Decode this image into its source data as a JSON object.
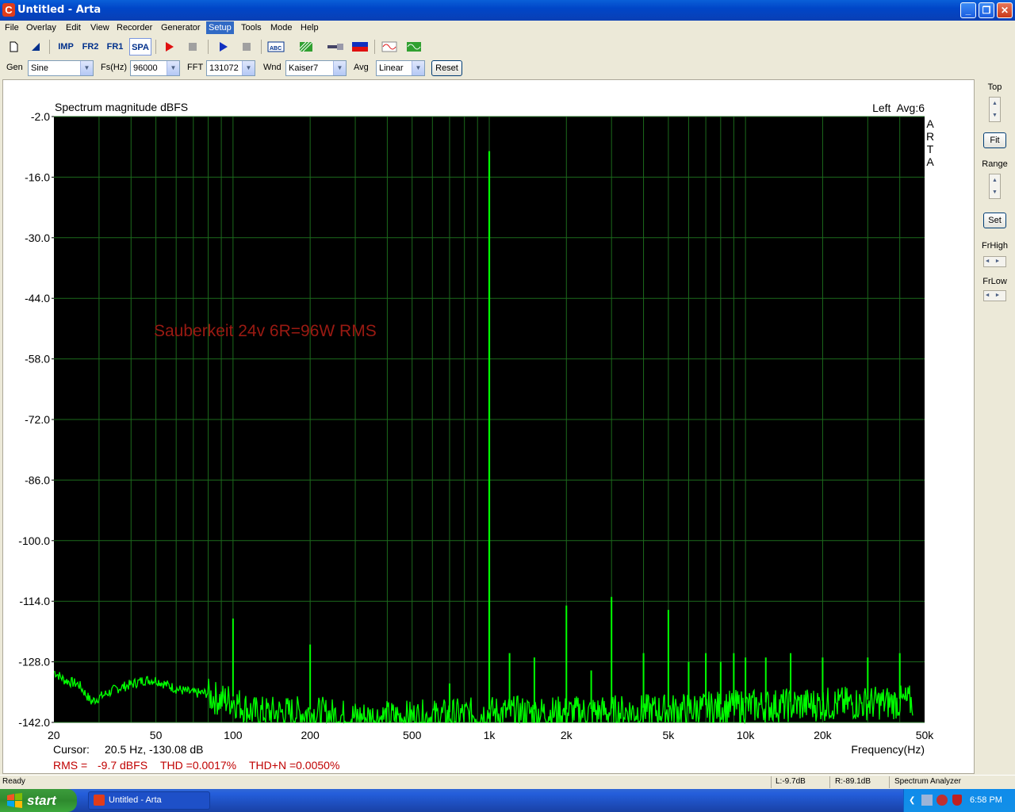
{
  "window": {
    "icon": "C",
    "title": "Untitled - Arta",
    "buttons": {
      "minimize": "_",
      "restore": "❐",
      "close": "✕"
    }
  },
  "menu": [
    "File",
    "Overlay",
    "Edit",
    "View",
    "Recorder",
    "Generator",
    "Setup",
    "Tools",
    "Mode",
    "Help"
  ],
  "menu_active": "Setup",
  "toolbar": {
    "imp": "IMP",
    "fr2": "FR2",
    "fr1": "FR1",
    "spa": "SPA",
    "icons": [
      "new-document-icon",
      "open-icon",
      "record-icon",
      "stop-icon",
      "play-icon",
      "stop-icon",
      "abc-icon",
      "hatch-icon",
      "cable-icon",
      "flag-icon",
      "sine-icon",
      "scope-icon"
    ]
  },
  "controls": {
    "gen_label": "Gen",
    "gen_value": "Sine",
    "fs_label": "Fs(Hz)",
    "fs_value": "96000",
    "fft_label": "FFT",
    "fft_value": "131072",
    "wnd_label": "Wnd",
    "wnd_value": "Kaiser7",
    "avg_label": "Avg",
    "avg_value": "Linear",
    "reset_label": "Reset"
  },
  "graph": {
    "title": "Spectrum magnitude dBFS",
    "channel": "Left  Avg:6",
    "brand": [
      "A",
      "R",
      "T",
      "A"
    ],
    "annotation": "Sauberkeit 24v 6R=96W RMS",
    "xlabel": "Frequency(Hz)",
    "cursor_label": "Cursor:",
    "cursor_value": "20.5 Hz, -130.08 dB",
    "rms_label": "RMS =",
    "rms_value": "-9.7 dBFS",
    "thd": "THD =0.0017%",
    "thdn": "THD+N =0.0050%",
    "colors": {
      "background": "#000000",
      "grid": "#1c6a1c",
      "trace": "#00ff00",
      "annotation": "#9a1a12",
      "readout": "#c00000"
    }
  },
  "chart_data": {
    "type": "line",
    "title": "Spectrum magnitude dBFS",
    "xlabel": "Frequency(Hz)",
    "ylabel": "",
    "xscale": "log",
    "xlim": [
      20,
      50000
    ],
    "ylim": [
      -142,
      -2
    ],
    "xticks": [
      20,
      50,
      100,
      200,
      500,
      1000,
      2000,
      5000,
      10000,
      20000,
      50000
    ],
    "xtick_labels": [
      "20",
      "50",
      "100",
      "200",
      "500",
      "1k",
      "2k",
      "5k",
      "10k",
      "20k",
      "50k"
    ],
    "yticks": [
      -2.0,
      -16.0,
      -30.0,
      -44.0,
      -58.0,
      -72.0,
      -86.0,
      -100.0,
      -114.0,
      -128.0,
      -142.0
    ],
    "ytick_labels": [
      "-2.0",
      "-16.0",
      "-30.0",
      "-44.0",
      "-58.0",
      "-72.0",
      "-86.0",
      "-100.0",
      "-114.0",
      "-128.0",
      "-142.0"
    ],
    "grid": true,
    "series": [
      {
        "color": "#00ff00",
        "noise_floor": [
          [
            20,
            -130
          ],
          [
            22,
            -132
          ],
          [
            25,
            -133
          ],
          [
            28,
            -137
          ],
          [
            30,
            -136
          ],
          [
            35,
            -134
          ],
          [
            40,
            -133
          ],
          [
            45,
            -132
          ],
          [
            50,
            -132
          ],
          [
            60,
            -134
          ],
          [
            70,
            -135
          ],
          [
            80,
            -135
          ],
          [
            90,
            -136
          ],
          [
            100,
            -136
          ],
          [
            120,
            -139
          ],
          [
            150,
            -139
          ],
          [
            200,
            -139
          ],
          [
            300,
            -140
          ],
          [
            500,
            -140
          ],
          [
            800,
            -139.5
          ],
          [
            1000,
            -139
          ],
          [
            2000,
            -139
          ],
          [
            5000,
            -138.5
          ],
          [
            10000,
            -137.5
          ],
          [
            20000,
            -137
          ],
          [
            45000,
            -136.5
          ]
        ],
        "peaks": [
          {
            "f": 100,
            "db": -118
          },
          {
            "f": 200,
            "db": -124
          },
          {
            "f": 700,
            "db": -133
          },
          {
            "f": 1000,
            "db": -10
          },
          {
            "f": 1200,
            "db": -126
          },
          {
            "f": 1500,
            "db": -127
          },
          {
            "f": 2000,
            "db": -115
          },
          {
            "f": 2500,
            "db": -130
          },
          {
            "f": 3000,
            "db": -113
          },
          {
            "f": 4000,
            "db": -126
          },
          {
            "f": 5000,
            "db": -116
          },
          {
            "f": 6000,
            "db": -128
          },
          {
            "f": 7000,
            "db": -126
          },
          {
            "f": 8000,
            "db": -128
          },
          {
            "f": 9000,
            "db": -126
          },
          {
            "f": 10000,
            "db": -127
          },
          {
            "f": 12000,
            "db": -127
          },
          {
            "f": 15000,
            "db": -126
          },
          {
            "f": 20000,
            "db": -127
          },
          {
            "f": 30000,
            "db": -127
          },
          {
            "f": 40000,
            "db": -126
          }
        ]
      }
    ]
  },
  "side": {
    "top_label": "Top",
    "fit_label": "Fit",
    "range_label": "Range",
    "set_label": "Set",
    "frhigh_label": "FrHigh",
    "frlow_label": "FrLow"
  },
  "status": {
    "ready": "Ready",
    "left_level": "L:-9.7dB",
    "right_level": "R:-89.1dB",
    "mode": "Spectrum Analyzer"
  },
  "taskbar": {
    "start": "start",
    "task": "Untitled - Arta",
    "clock": "6:58 PM"
  }
}
